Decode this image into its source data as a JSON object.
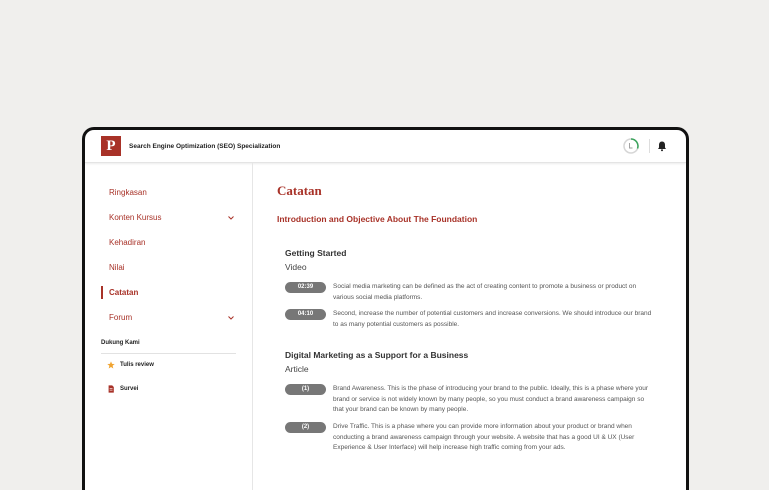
{
  "header": {
    "logo_letter": "P",
    "course_title": "Search Engine Optimization (SEO) Specialization"
  },
  "sidebar": {
    "items": [
      {
        "label": "Ringkasan"
      },
      {
        "label": "Konten Kursus"
      },
      {
        "label": "Kehadiran"
      },
      {
        "label": "Nilai"
      },
      {
        "label": "Catatan"
      },
      {
        "label": "Forum"
      }
    ],
    "active": "Catatan",
    "support": {
      "title": "Dukung Kami",
      "items": [
        {
          "label": "Tulis review"
        },
        {
          "label": "Survei"
        }
      ]
    }
  },
  "main": {
    "page_title": "Catatan",
    "section_title": "Introduction and Objective About The Foundation",
    "groups": [
      {
        "title": "Getting Started",
        "type": "Video",
        "items": [
          {
            "badge": "02:39",
            "text": "Social media marketing can be defined as the act of creating content to promote a business or product on various social media platforms."
          },
          {
            "badge": "04:10",
            "text": "Second, increase the number of potential customers and increase conversions. We should introduce our brand to as many potential customers as possible."
          }
        ]
      },
      {
        "title": "Digital Marketing as a Support for a Business",
        "type": "Article",
        "items": [
          {
            "badge": "(1)",
            "text": "Brand Awareness. This is the phase of introducing your brand to the public. Ideally, this is a phase where your brand or service is not widely known by many people, so you must conduct a brand awareness campaign so that your brand can be known by many people."
          },
          {
            "badge": "(2)",
            "text": "Drive Traffic. This is a phase where you can provide more information about your product or brand when conducting a brand awareness campaign through your website. A website that has a good UI & UX (User Experience & User Interface) will help increase high traffic coming from your ads."
          }
        ]
      }
    ]
  },
  "colors": {
    "accent": "#a83228",
    "badge": "#777777",
    "progress": "#3aa35b"
  },
  "icons": {
    "progress": "progress-ring-icon",
    "bell": "bell-icon",
    "chevron": "chevron-down-icon",
    "star": "star-icon",
    "survey": "document-icon"
  }
}
